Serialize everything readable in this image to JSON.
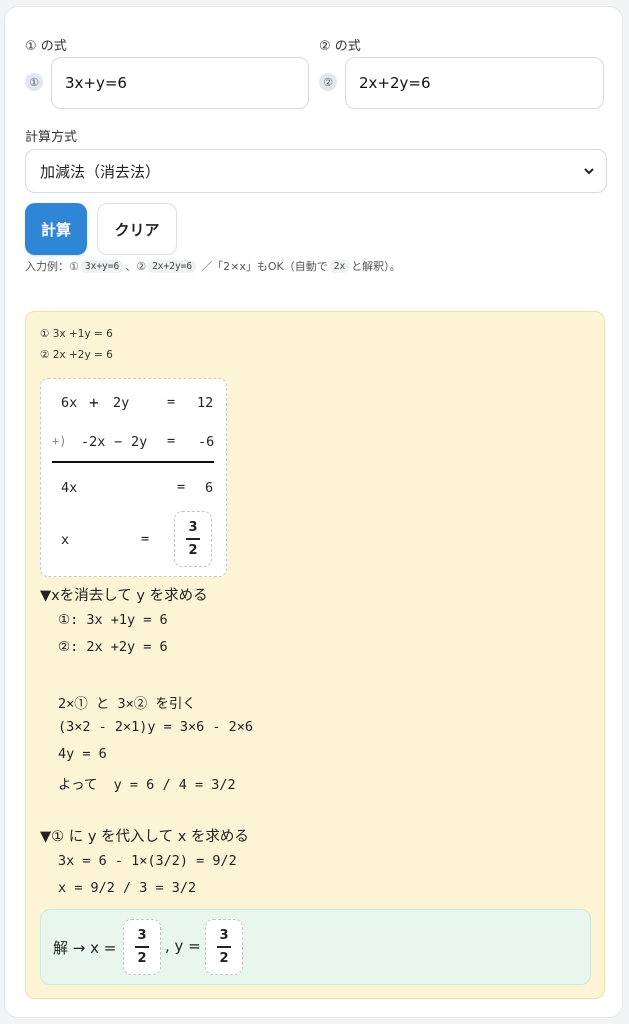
{
  "form": {
    "eq1_label": "① の式",
    "eq2_label": "② の式",
    "eq1_marker": "①",
    "eq2_marker": "②",
    "eq1_value": "3x+y=6",
    "eq2_value": "2x+2y=6",
    "method_label": "計算方式",
    "method_value": "加減法（消去法）",
    "calc_button": "計算",
    "clear_button": "クリア",
    "hint_prefix": "入力例：①",
    "hint_ex1": "3x+y=6",
    "hint_mid": "、②",
    "hint_ex2": "2x+2y=6",
    "hint_mid2": "／「2×x」もOK（自動で",
    "hint_ex3": "2x",
    "hint_suffix": "と解釈）。"
  },
  "result": {
    "eq1_normalized": "① 3x +1y = 6",
    "eq2_normalized": "② 2x +2y = 6",
    "elim": {
      "row1": [
        "6x",
        "+",
        "2y",
        "=",
        "12"
      ],
      "row2": [
        "+)",
        "-2x",
        "−",
        "2y",
        "=",
        "-6"
      ],
      "row3": [
        "4x",
        "=",
        "6"
      ],
      "row4": [
        "x",
        "=",
        "3",
        "2"
      ]
    },
    "section1_title": "▼xを消去して y を求める",
    "section1_lines": [
      "①: 3x +1y = 6",
      "②: 2x +2y = 6",
      "2×① と 3×② を引く",
      "(3×2 - 2×1)y = 3×6 - 2×6",
      "4y = 6",
      "よって  y = 6 / 4 = 3/2"
    ],
    "section2_title": "▼① に y を代入して x を求める",
    "section2_lines": [
      "3x = 6 - 1×(3/2) = 9/2",
      "x = 9/2 / 3 = 3/2"
    ],
    "answer": {
      "prefix": "解 → x =",
      "x_num": "3",
      "x_den": "2",
      "mid": ", y =",
      "y_num": "3",
      "y_den": "2"
    }
  },
  "colors": {
    "primary": "#2f86d6",
    "result_bg": "#fdf4d6",
    "answer_bg": "#e9f6ee"
  }
}
